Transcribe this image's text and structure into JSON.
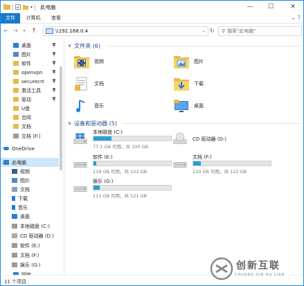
{
  "window": {
    "title": "此电脑",
    "controls": {
      "minimize": "—",
      "maximize": "☐",
      "close": "✕"
    }
  },
  "ribbon": {
    "tabs": [
      "文件",
      "计算机",
      "查看"
    ],
    "active_tab": "文件",
    "accent_color": "#1979ca"
  },
  "address": {
    "value": "\\\\192.168.0.4",
    "dropdown_glyph": "⌄",
    "refresh_glyph": "↻"
  },
  "search": {
    "placeholder": "搜索\"此电脑\""
  },
  "nav": {
    "items": [
      {
        "label": "桌面",
        "icon": "desktop-icon",
        "pinned": true
      },
      {
        "label": "图片",
        "icon": "pictures-icon",
        "pinned": true
      },
      {
        "label": "软件",
        "icon": "folder-icon",
        "pinned": true
      },
      {
        "label": "openvpn",
        "icon": "folder-icon",
        "pinned": true
      },
      {
        "label": "securecrt",
        "icon": "folder-icon",
        "pinned": true
      },
      {
        "label": "激活工具",
        "icon": "folder-icon",
        "pinned": true
      },
      {
        "label": "驱动",
        "icon": "folder-icon",
        "pinned": true
      },
      {
        "label": "U盘",
        "icon": "folder-icon",
        "pinned": false
      },
      {
        "label": "合同",
        "icon": "folder-icon",
        "pinned": false
      },
      {
        "label": "文档",
        "icon": "folder-icon",
        "pinned": false
      },
      {
        "label": "文档 (F:)",
        "icon": "drive-icon",
        "pinned": false
      },
      {
        "label": "OneDrive",
        "icon": "onedrive-icon",
        "pinned": false
      },
      {
        "label": "此电脑",
        "icon": "this-pc-icon",
        "pinned": false,
        "selected": true
      },
      {
        "label": "视频",
        "icon": "videos-icon",
        "pinned": false
      },
      {
        "label": "图片",
        "icon": "pictures-icon",
        "pinned": false
      },
      {
        "label": "文档",
        "icon": "documents-icon",
        "pinned": false
      },
      {
        "label": "下载",
        "icon": "downloads-icon",
        "pinned": false
      },
      {
        "label": "音乐",
        "icon": "music-icon",
        "pinned": false
      },
      {
        "label": "桌面",
        "icon": "desktop-icon",
        "pinned": false
      },
      {
        "label": "本地磁盘 (C:)",
        "icon": "drive-icon",
        "pinned": false
      },
      {
        "label": "CD 驱动器 (D:)",
        "icon": "cd-drive-icon",
        "pinned": false
      },
      {
        "label": "软件 (E:)",
        "icon": "drive-icon",
        "pinned": false
      },
      {
        "label": "文档 (F:)",
        "icon": "drive-icon",
        "pinned": false
      },
      {
        "label": "娱乐 (G:)",
        "icon": "drive-icon",
        "pinned": false
      },
      {
        "label": "网络",
        "icon": "network-icon",
        "pinned": false
      }
    ]
  },
  "main": {
    "folders_header": "文件夹 (6)",
    "folders": [
      {
        "label": "视频",
        "icon": "videos-folder-icon"
      },
      {
        "label": "图片",
        "icon": "pictures-folder-icon"
      },
      {
        "label": "文档",
        "icon": "documents-folder-icon"
      },
      {
        "label": "下载",
        "icon": "downloads-folder-icon"
      },
      {
        "label": "音乐",
        "icon": "music-folder-icon"
      },
      {
        "label": "桌面",
        "icon": "desktop-folder-icon"
      }
    ],
    "drives_header": "设备和驱动器 (5)",
    "drives": [
      {
        "name": "本地磁盘 (C:)",
        "free": "77.1 GB 可用，共 100 GB",
        "used_fraction": 0.229,
        "icon": "windows-drive-icon"
      },
      {
        "name": "CD 驱动器 (D:)",
        "free": "",
        "used_fraction": null,
        "icon": "cd-drive-icon"
      },
      {
        "name": "软件 (E:)",
        "free": "118 GB 可用，共 122 GB",
        "used_fraction": 0.033,
        "icon": "drive-icon"
      },
      {
        "name": "文档 (F:)",
        "free": "110 GB 可用，共 122 GB",
        "used_fraction": 0.098,
        "icon": "drive-icon"
      },
      {
        "name": "娱乐 (G:)",
        "free": "111 GB 可用，共 121 GB",
        "used_fraction": 0.083,
        "icon": "drive-icon"
      }
    ],
    "bar_color": "#26a0da",
    "header_color": "#1e4b8a"
  },
  "status": {
    "item_count": "11 个项目"
  },
  "watermark": {
    "text_cn": "创新互联",
    "text_en": "CHUANG XIN HU LIAN"
  }
}
